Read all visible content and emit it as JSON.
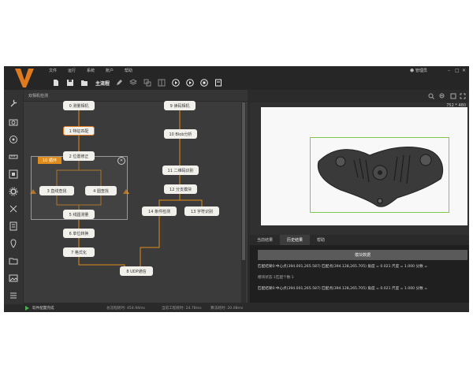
{
  "menu": [
    "文件",
    "运行",
    "系统",
    "账户",
    "帮助"
  ],
  "user": "管理员",
  "toolbar": {
    "process_label": "主流程"
  },
  "flow": {
    "title": "双相机检测",
    "loop_label": "10 循环",
    "nodes": [
      {
        "id": "n0",
        "label": "0 测量相机"
      },
      {
        "id": "n1",
        "label": "1 特征匹配"
      },
      {
        "id": "n2",
        "label": "2 位置修正"
      },
      {
        "id": "n3",
        "label": "3 直线查找"
      },
      {
        "id": "n4",
        "label": "4 圆查找"
      },
      {
        "id": "n5",
        "label": "5 线圆测量"
      },
      {
        "id": "n6",
        "label": "6 单位转换"
      },
      {
        "id": "n7",
        "label": "7 格式化"
      },
      {
        "id": "n8",
        "label": "8 UDP通信"
      },
      {
        "id": "n9",
        "label": "9 读码相机"
      },
      {
        "id": "n10",
        "label": "10 Blob分析"
      },
      {
        "id": "n11",
        "label": "11 二维码识别"
      },
      {
        "id": "n12",
        "label": "12 分支模块"
      },
      {
        "id": "n13",
        "label": "13 字符识别"
      },
      {
        "id": "n14",
        "label": "14 条件检测"
      }
    ]
  },
  "image": {
    "resolution": "752 * 480"
  },
  "tabs": [
    "当前结果",
    "历史结果",
    "帮助"
  ],
  "results": {
    "header": "模块数据",
    "line1": "匹配结果0:中心点(394.001,265.587) 匹配点(394.128,265.705) 角度 = 0.021 尺度 = 1.000 分数 =",
    "line2": "模块状态:1匹配个数:1",
    "line3": "匹配结果0:中心点(394.001,265.587) 匹配点(394.128,265.705) 角度 = 0.021 尺度 = 1.000 分数 ="
  },
  "status": {
    "state": "软件配置完成",
    "proc_time": "总流程耗时: 454.94ms",
    "cur_time": "当前工程耗时: 24.78ms",
    "algo_time": "算法耗时: 20.08ms"
  },
  "colors": {
    "accent": "#e07a1e",
    "loop": "#e08c1a",
    "roi": "#7ec850"
  }
}
